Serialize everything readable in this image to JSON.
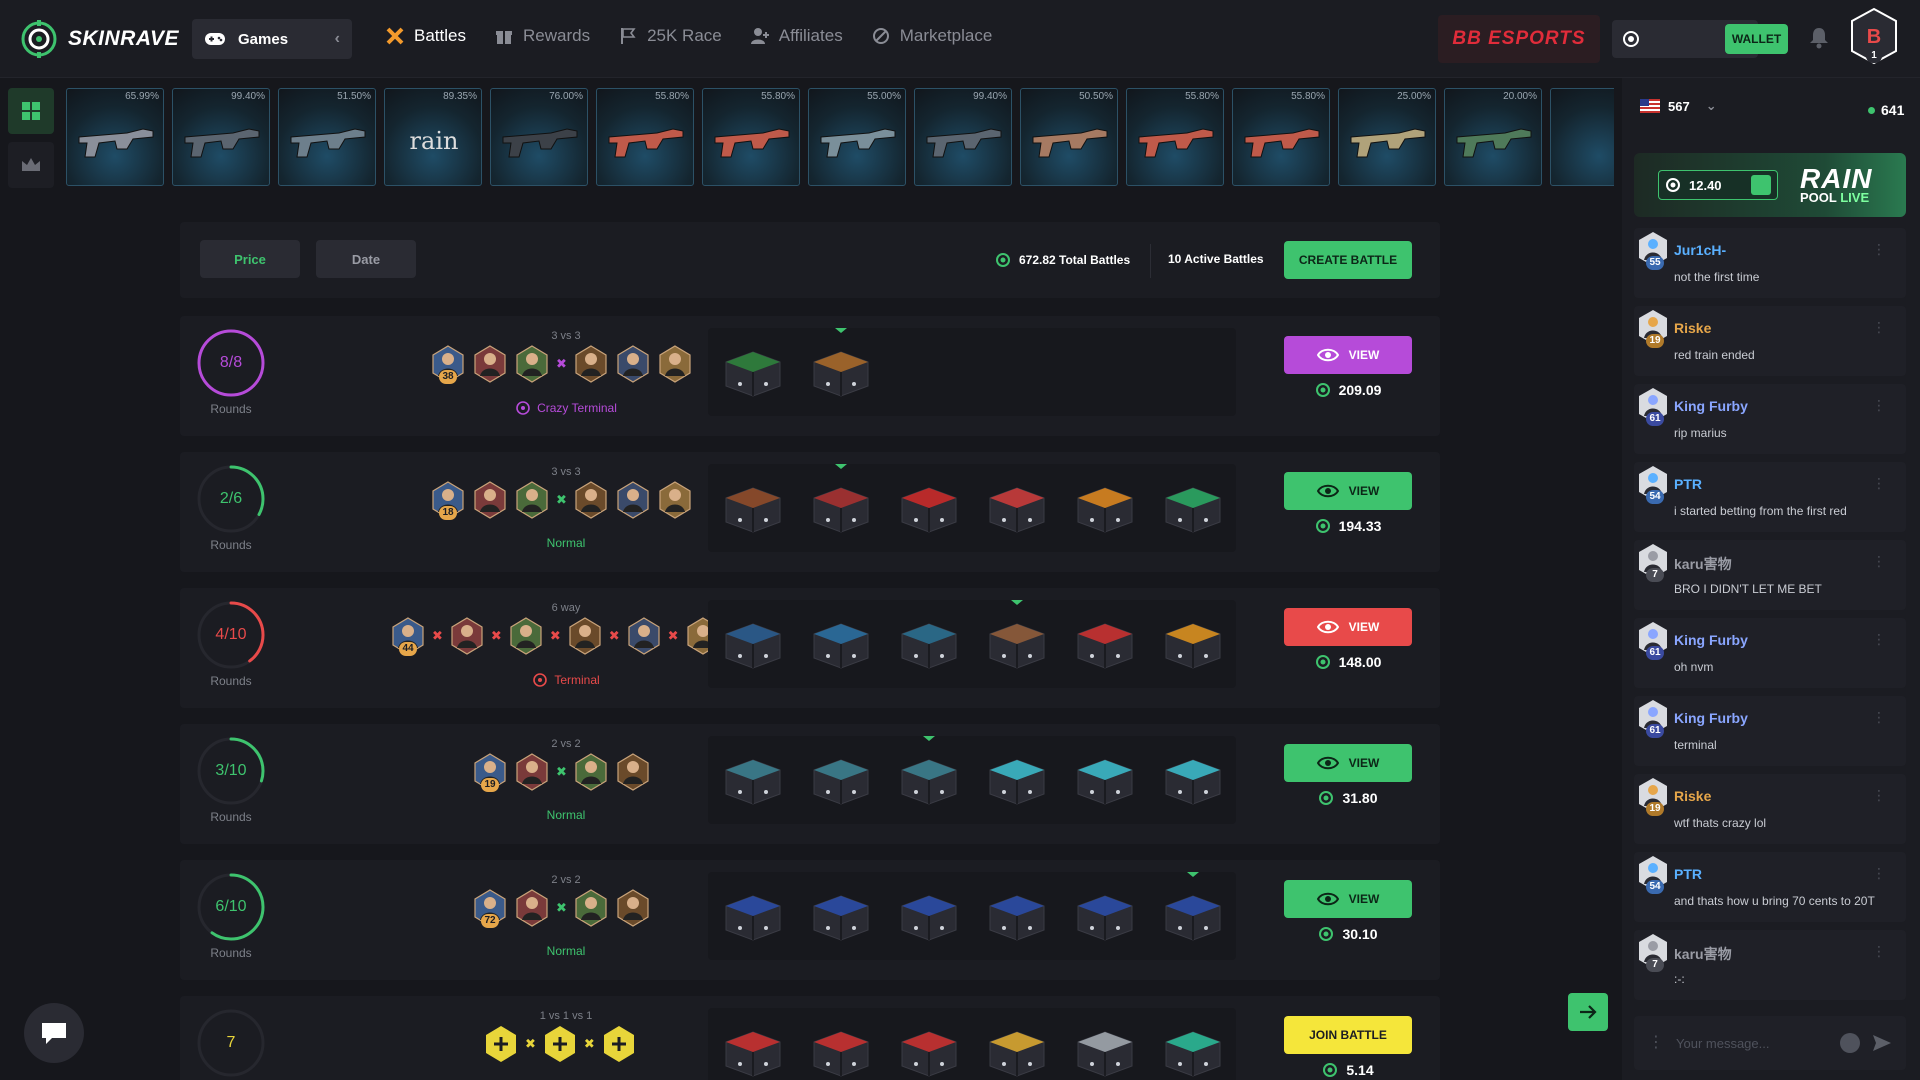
{
  "nav": {
    "logo": "SKINRAVE",
    "games_label": "Games",
    "links": [
      {
        "label": "Battles",
        "icon": "battles-icon",
        "active": true
      },
      {
        "label": "Rewards",
        "icon": "gift-icon",
        "active": false
      },
      {
        "label": "25K Race",
        "icon": "flag-icon",
        "active": false
      },
      {
        "label": "Affiliates",
        "icon": "user-plus-icon",
        "active": false
      },
      {
        "label": "Marketplace",
        "icon": "marketplace-icon",
        "active": false
      }
    ],
    "sponsor": "BB ESPORTS",
    "wallet_label": "WALLET",
    "avatar_level": "1"
  },
  "strip": {
    "items": [
      {
        "pct": "65.99%",
        "color": "#8a8f9a"
      },
      {
        "pct": "99.40%",
        "color": "#5b6570"
      },
      {
        "pct": "51.50%",
        "color": "#6d7f8c"
      },
      {
        "pct": "89.35%",
        "color": "#c9c9c9",
        "label": "rain"
      },
      {
        "pct": "76.00%",
        "color": "#3c4148"
      },
      {
        "pct": "55.80%",
        "color": "#c05a4a"
      },
      {
        "pct": "55.80%",
        "color": "#c05a4a"
      },
      {
        "pct": "55.00%",
        "color": "#7a8f9a"
      },
      {
        "pct": "99.40%",
        "color": "#5b6570"
      },
      {
        "pct": "50.50%",
        "color": "#a67a62"
      },
      {
        "pct": "55.80%",
        "color": "#c05a4a"
      },
      {
        "pct": "55.80%",
        "color": "#c05a4a"
      },
      {
        "pct": "25.00%",
        "color": "#b0a27a"
      },
      {
        "pct": "20.00%",
        "color": "#4f7a5a"
      }
    ]
  },
  "filters": {
    "price_label": "Price",
    "date_label": "Date",
    "total_battles": "672.82 Total Battles",
    "active_battles": "10 Active Battles",
    "create_label": "CREATE BATTLE"
  },
  "battles": [
    {
      "rounds": "8/8",
      "progress": 1.0,
      "ring_color": "#b64bd9",
      "mode": "3 vs 3",
      "type": "Crazy Terminal",
      "type_color": "#b64bd9",
      "type_icon": "crazy-terminal-icon",
      "players": 6,
      "split": 3,
      "sep": "x",
      "sep_color": "#b64bd9",
      "first_level": "38",
      "cases": [
        "#2e7d3c",
        "#a0652a"
      ],
      "caret": 1,
      "btn_label": "VIEW",
      "btn_color": "#b64bd9",
      "btn_text": "#ffffff",
      "price": "209.09"
    },
    {
      "rounds": "2/6",
      "progress": 0.33,
      "ring_color": "#3ec36e",
      "mode": "3 vs 3",
      "type": "Normal",
      "type_color": "#3ec36e",
      "type_icon": "",
      "players": 6,
      "split": 3,
      "sep": "x",
      "sep_color": "#3ec36e",
      "first_level": "18",
      "cases": [
        "#8a4a2a",
        "#a03030",
        "#c02a2a",
        "#c03a3a",
        "#d08020",
        "#2aa060"
      ],
      "caret": 1,
      "btn_label": "VIEW",
      "btn_color": "#3ec36e",
      "btn_text": "#0c2617",
      "price": "194.33"
    },
    {
      "rounds": "4/10",
      "progress": 0.4,
      "ring_color": "#e84a4a",
      "mode": "6 way",
      "type": "Terminal",
      "type_color": "#e84a4a",
      "type_icon": "terminal-icon",
      "players": 6,
      "split": 1,
      "sep": "x",
      "sep_color": "#e84a4a",
      "first_level": "44",
      "cases": [
        "#2a5a8a",
        "#2a6a9a",
        "#2a6a8a",
        "#8a5a3a",
        "#c03030",
        "#d08a20"
      ],
      "caret": 3,
      "btn_label": "VIEW",
      "btn_color": "#e84a4a",
      "btn_text": "#ffffff",
      "price": "148.00"
    },
    {
      "rounds": "3/10",
      "progress": 0.3,
      "ring_color": "#3ec36e",
      "mode": "2 vs 2",
      "type": "Normal",
      "type_color": "#3ec36e",
      "type_icon": "",
      "players": 4,
      "split": 2,
      "sep": "x",
      "sep_color": "#3ec36e",
      "first_level": "19",
      "cases": [
        "#3a7a8a",
        "#3a7a8a",
        "#3a7a8a",
        "#3ab0c0",
        "#3ab0c0",
        "#3ab0c0"
      ],
      "caret": 2,
      "btn_label": "VIEW",
      "btn_color": "#3ec36e",
      "btn_text": "#0c2617",
      "price": "31.80"
    },
    {
      "rounds": "6/10",
      "progress": 0.6,
      "ring_color": "#3ec36e",
      "mode": "2 vs 2",
      "type": "Normal",
      "type_color": "#3ec36e",
      "type_icon": "",
      "players": 4,
      "split": 2,
      "sep": "x",
      "sep_color": "#3ec36e",
      "first_level": "72",
      "cases": [
        "#2a4aa0",
        "#2a4aa0",
        "#2a4aa0",
        "#2a4aa0",
        "#2a4aa0",
        "#2a4aa0"
      ],
      "caret": 5,
      "btn_label": "VIEW",
      "btn_color": "#3ec36e",
      "btn_text": "#0c2617",
      "price": "30.10"
    },
    {
      "rounds": "7",
      "progress": 0,
      "ring_color": "#e8d53a",
      "mode": "1 vs 1 vs 1",
      "type": "",
      "type_color": "#e8d53a",
      "type_icon": "",
      "players": 3,
      "split": 1,
      "sep": "x",
      "sep_color": "#e8d53a",
      "first_level": "",
      "cases": [
        "#c03030",
        "#c03030",
        "#c03030",
        "#d0a030",
        "#9aa0a8",
        "#2ab090"
      ],
      "caret": -1,
      "btn_label": "JOIN BATTLE",
      "btn_color": "#f5e63a",
      "btn_text": "#1b1c22",
      "price": "5.14"
    }
  ],
  "rounds_label": "Rounds",
  "chat": {
    "country_count": "567",
    "online_count": "641",
    "rain_amount": "12.40",
    "rain_title": "RAIN",
    "rain_pool": "POOL",
    "rain_live": "LIVE",
    "messages": [
      {
        "user": "Jur1cH-",
        "text": "not the first time",
        "level": "55",
        "color": "#5ab0ff",
        "lvl_bg": "#3a6ab0"
      },
      {
        "user": "Riske",
        "text": "red train ended",
        "level": "19",
        "color": "#e6a64a",
        "lvl_bg": "#b07a2a"
      },
      {
        "user": "King Furby",
        "text": "rip marius",
        "level": "61",
        "color": "#8aa6ff",
        "lvl_bg": "#3a4aa0"
      },
      {
        "user": "PTR",
        "text": "i started betting from the first red",
        "level": "54",
        "color": "#5ab0ff",
        "lvl_bg": "#3a6ab0"
      },
      {
        "user": "karu害物",
        "text": "BRO I DIDN'T LET ME BET",
        "level": "7",
        "color": "#9a9ca5",
        "lvl_bg": "#4a4c55"
      },
      {
        "user": "King Furby",
        "text": "oh nvm",
        "level": "61",
        "color": "#8aa6ff",
        "lvl_bg": "#3a4aa0"
      },
      {
        "user": "King Furby",
        "text": "terminal",
        "level": "61",
        "color": "#8aa6ff",
        "lvl_bg": "#3a4aa0"
      },
      {
        "user": "Riske",
        "text": "wtf thats crazy lol",
        "level": "19",
        "color": "#e6a64a",
        "lvl_bg": "#b07a2a"
      },
      {
        "user": "PTR",
        "text": "and thats how u bring 70 cents to 20T",
        "level": "54",
        "color": "#5ab0ff",
        "lvl_bg": "#3a6ab0"
      },
      {
        "user": "karu害物",
        "text": ":-:",
        "level": "7",
        "color": "#9a9ca5",
        "lvl_bg": "#4a4c55"
      }
    ],
    "input_placeholder": "Your message..."
  },
  "colors": {
    "accent": "#3ec36e",
    "bg": "#16171c",
    "panel": "#1b1c22"
  }
}
